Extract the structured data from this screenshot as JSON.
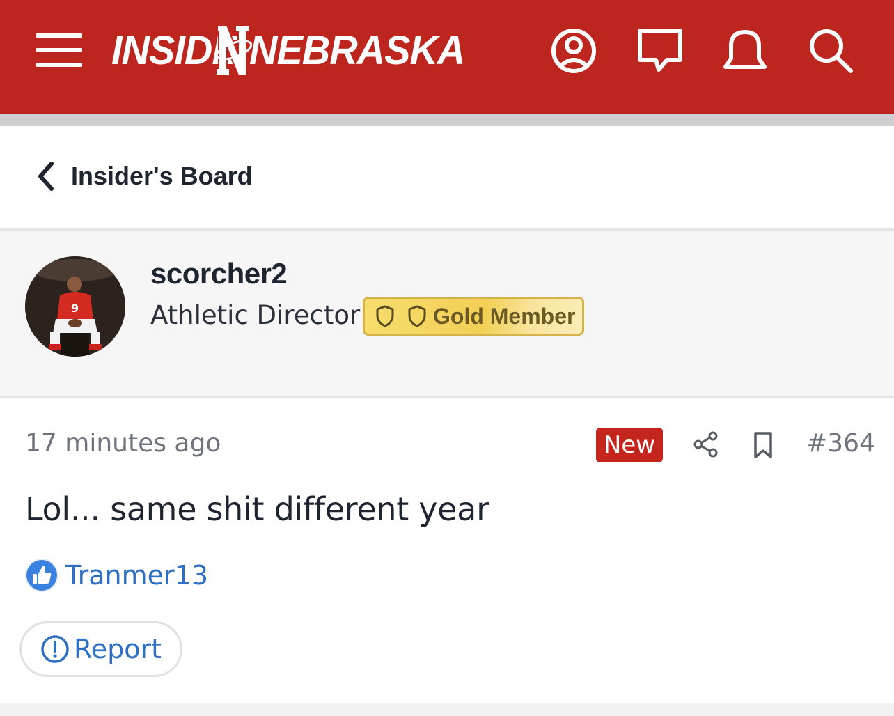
{
  "header": {
    "logo": {
      "left": "INSIDE",
      "right": "NEBRASKA"
    },
    "icons": [
      "menu-icon",
      "profile-icon",
      "chat-icon",
      "notification-bell-icon",
      "search-icon"
    ]
  },
  "breadcrumb": {
    "label": "Insider's Board"
  },
  "author": {
    "username": "scorcher2",
    "role": "Athletic Director",
    "badge": "Gold Member"
  },
  "post": {
    "timestamp": "17 minutes ago",
    "new_label": "New",
    "number": "#364",
    "body": "Lol... same shit different year",
    "reaction": {
      "user": "Tranmer13",
      "icon": "thumbs-up-icon"
    },
    "report_label": "Report"
  },
  "colors": {
    "brand_red": "#bd261e",
    "gold_badge": "#f3cf55",
    "link_blue": "#2f6fc2",
    "new_badge": "#c4261e"
  }
}
